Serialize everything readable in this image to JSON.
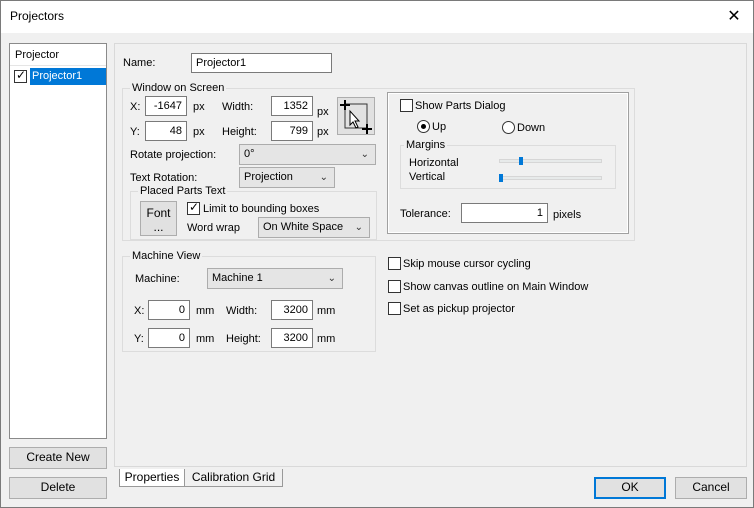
{
  "window": {
    "title": "Projectors"
  },
  "left": {
    "list_header": "Projector",
    "items": [
      {
        "label": "Projector1",
        "checked": true
      }
    ],
    "create_new": "Create New",
    "delete": "Delete"
  },
  "props": {
    "name_label": "Name:",
    "name_value": "Projector1",
    "window_on_screen": {
      "title": "Window on Screen",
      "x_label": "X:",
      "x_value": "-1647",
      "x_unit": "px",
      "width_label": "Width:",
      "width_value": "1352",
      "width_unit": "px",
      "y_label": "Y:",
      "y_value": "48",
      "y_unit": "px",
      "height_label": "Height:",
      "height_value": "799",
      "height_unit": "px",
      "rotate_label": "Rotate projection:",
      "rotate_value": "0°",
      "text_rotation_label": "Text Rotation:",
      "text_rotation_value": "Projection"
    },
    "placed_parts": {
      "title": "Placed Parts Text",
      "font_button_line1": "Font",
      "font_button_line2": "...",
      "limit_label": "Limit to bounding boxes",
      "word_wrap_label": "Word wrap",
      "word_wrap_value": "On White Space"
    },
    "parts_dialog": {
      "show_label": "Show Parts Dialog",
      "up_label": "Up",
      "down_label": "Down",
      "margins_title": "Margins",
      "horizontal_label": "Horizontal",
      "vertical_label": "Vertical",
      "horizontal_level": 0.2,
      "vertical_level": 0.0,
      "tolerance_label": "Tolerance:",
      "tolerance_value": "1",
      "tolerance_unit": "pixels"
    },
    "machine_view": {
      "title": "Machine View",
      "machine_label": "Machine:",
      "machine_value": "Machine 1",
      "x_label": "X:",
      "x_value": "0",
      "x_unit": "mm",
      "width_label": "Width:",
      "width_value": "3200",
      "width_unit": "mm",
      "y_label": "Y:",
      "y_value": "0",
      "y_unit": "mm",
      "height_label": "Height:",
      "height_value": "3200",
      "height_unit": "mm"
    },
    "options": {
      "skip_cursor": "Skip mouse cursor cycling",
      "show_outline": "Show canvas outline on Main Window",
      "pickup": "Set as pickup projector"
    }
  },
  "tabs": [
    "Properties",
    "Calibration Grid"
  ],
  "footer": {
    "ok": "OK",
    "cancel": "Cancel"
  },
  "icons": {
    "close": "close-icon",
    "crosshair": "crosshair-pick-icon",
    "dropdown": "chevron-down-icon"
  },
  "colors": {
    "accent": "#0078d7",
    "selection": "#0078d7"
  }
}
